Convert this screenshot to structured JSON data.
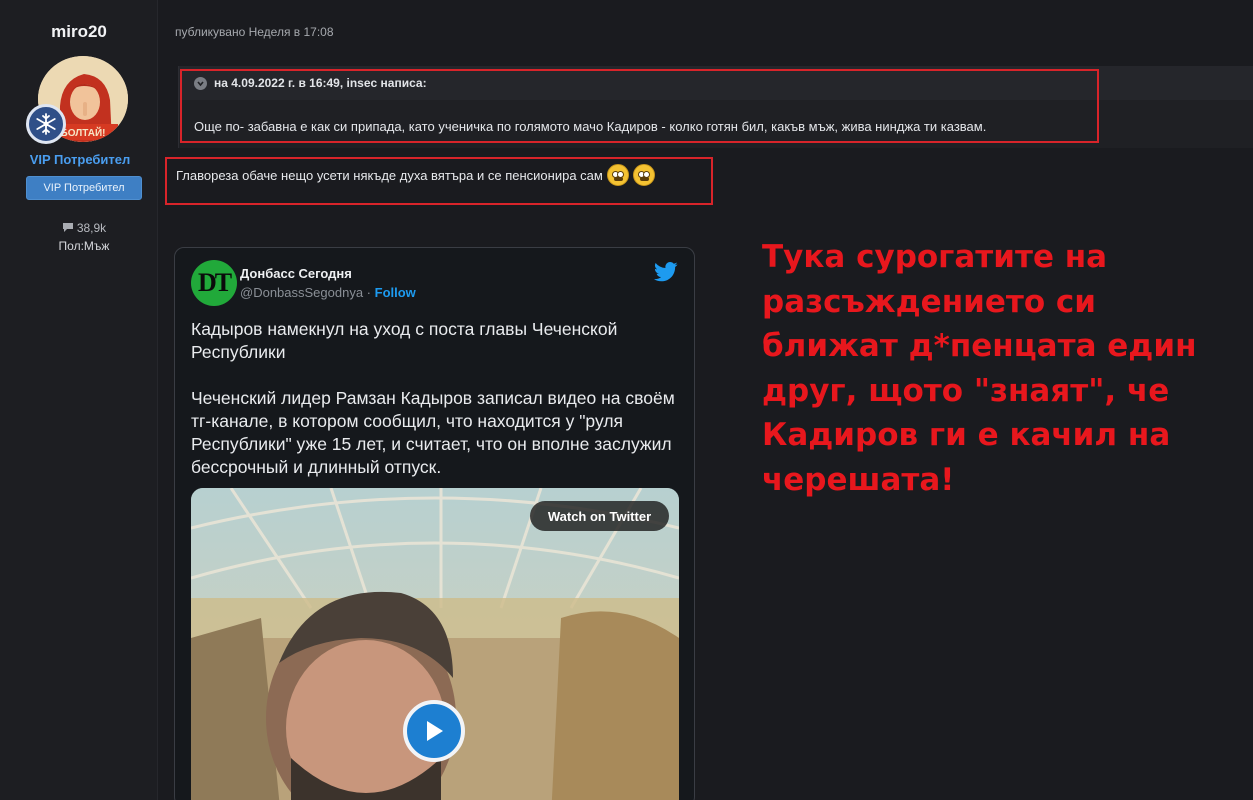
{
  "author": {
    "name": "miro20",
    "avatar_caption": "БОЛТАЙ!",
    "title": "VIP Потребител",
    "group_badge": "VIP Потребител",
    "post_count": "38,9k",
    "gender": "Пол:Мъж"
  },
  "post": {
    "meta": "публикувано Неделя в 17:08",
    "quote": {
      "citation": "на 4.09.2022 г. в 16:49, insec написа:",
      "text": "Още по- забавна е как си припада, като ученичка по голямото мачо Кадиров - колко готян бил, какъв мъж, жива нинджа ти казвам."
    },
    "reply_text": "Главореза обаче нещо усети някъде духа вятъра и се пенсионира сам"
  },
  "tweet": {
    "avatar_initials": "DT",
    "display_name": "Донбасс Сегодня",
    "handle": "@DonbassSegodnya",
    "separator": " · ",
    "follow_label": "Follow",
    "paragraph_1": "Кадыров намекнул на уход с поста главы Чеченской Республики",
    "paragraph_2": "Чеченский лидер Рамзан Кадыров записал видео на своём тг-канале, в котором сообщил, что находится у \"руля Республики\" уже 15 лет, и считает, что он вполне заслужил бессрочный и длинный отпуск.",
    "watch_label": "Watch on Twitter"
  },
  "annotation": {
    "text": "Тука сурогатите на разсъждението си ближат д*пенцата един друг, щото \"знаят\", че Кадиров ги е качил на черешата!"
  },
  "colors": {
    "background": "#1a1b1f",
    "link_blue": "#4a9ef0",
    "highlight_red": "#d8242a",
    "annotation_red": "#e8171d",
    "twitter_blue": "#1d9bf0"
  },
  "icons": [
    "snowflake-rank-icon",
    "speech-bubble-icon",
    "chevron-down-icon",
    "grimacing-emoji-icon",
    "twitter-bird-icon",
    "play-icon"
  ]
}
